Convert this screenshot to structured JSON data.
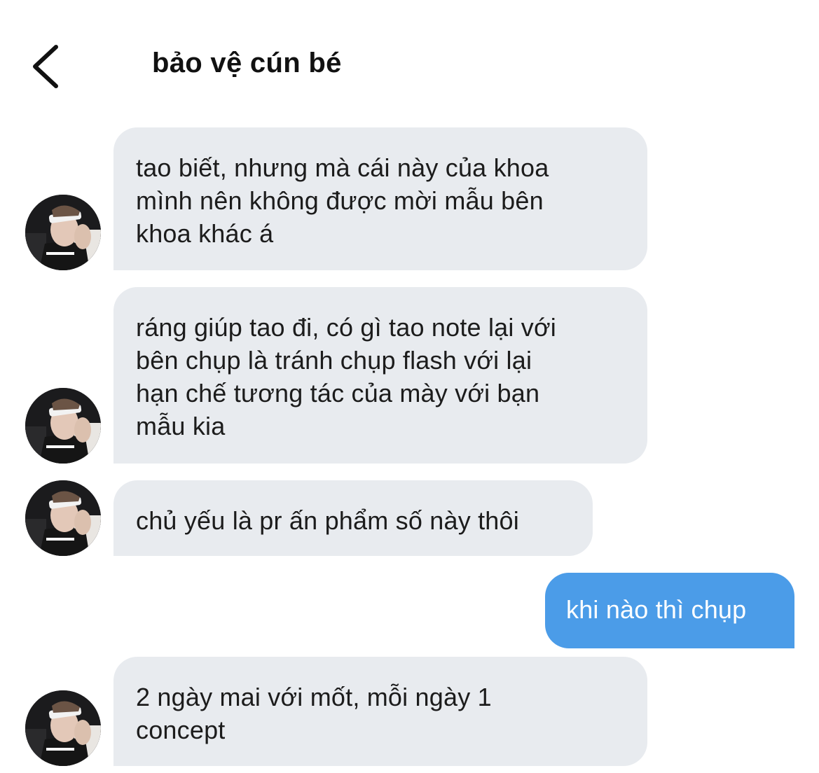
{
  "header": {
    "title": "bảo vệ cún bé",
    "back_icon": "chevron-left-icon"
  },
  "messages": [
    {
      "direction": "incoming",
      "lines": [
        "tao biết, nhưng mà cái này của khoa",
        "mình nên không được mời mẫu bên",
        "khoa khác á"
      ]
    },
    {
      "direction": "incoming",
      "lines": [
        "ráng giúp tao đi, có gì tao note lại với",
        "bên chụp là tránh chụp flash với lại",
        "hạn chế tương tác của mày với bạn",
        "mẫu kia"
      ]
    },
    {
      "direction": "incoming",
      "lines": [
        "chủ yếu là pr ấn phẩm số này thôi"
      ]
    },
    {
      "direction": "outgoing",
      "lines": [
        "khi nào thì chụp"
      ]
    },
    {
      "direction": "incoming",
      "lines": [
        "2 ngày mai với mốt, mỗi ngày 1",
        "concept"
      ]
    }
  ],
  "colors": {
    "incoming_bubble": "#e8ebef",
    "outgoing_bubble": "#4b9ce8",
    "text": "#1c1c1c"
  }
}
